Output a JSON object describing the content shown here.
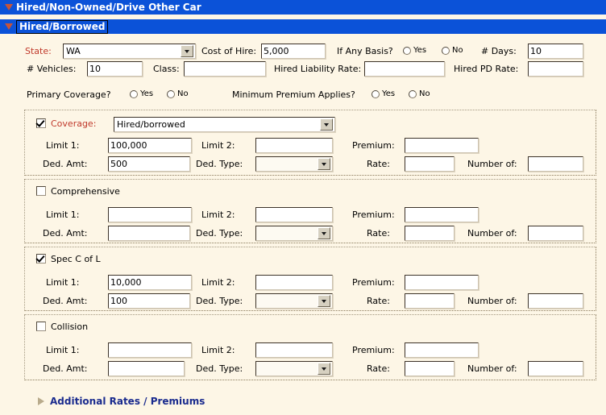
{
  "window": {
    "title": "Hired/Non-Owned/Drive Other Car",
    "subsection_title": "Hired/Borrowed",
    "collapse_icon": "triangle-down-icon"
  },
  "top_form": {
    "state": {
      "label": "State:",
      "value": "WA"
    },
    "cost_of_hire": {
      "label": "Cost of Hire:",
      "value": "5,000"
    },
    "if_any_basis": {
      "label": "If Any Basis?",
      "yes": "Yes",
      "no": "No",
      "selected": ""
    },
    "num_days": {
      "label": "# Days:",
      "value": "10"
    },
    "num_vehicles": {
      "label": "# Vehicles:",
      "value": "10"
    },
    "class": {
      "label": "Class:",
      "value": ""
    },
    "hired_liability_rate": {
      "label": "Hired Liability Rate:",
      "value": ""
    },
    "hired_pd_rate": {
      "label": "Hired PD Rate:",
      "value": ""
    },
    "primary_coverage": {
      "label": "Primary Coverage?",
      "yes": "Yes",
      "no": "No",
      "selected": ""
    },
    "minimum_premium": {
      "label": "Minimum Premium Applies?",
      "yes": "Yes",
      "no": "No",
      "selected": ""
    }
  },
  "field_labels": {
    "limit1": "Limit 1:",
    "limit2": "Limit 2:",
    "premium": "Premium:",
    "ded_amt": "Ded. Amt:",
    "ded_type": "Ded. Type:",
    "rate": "Rate:",
    "number_of": "Number of:"
  },
  "panels": [
    {
      "checkbox_label": "Coverage:",
      "checked": true,
      "label_required": true,
      "has_combo": true,
      "combo_value": "Hired/borrowed",
      "limit1": "100,000",
      "limit2": "",
      "premium": "",
      "ded_amt": "500",
      "ded_type": "",
      "rate": "",
      "number_of": ""
    },
    {
      "checkbox_label": "Comprehensive",
      "checked": false,
      "label_required": false,
      "has_combo": false,
      "combo_value": "",
      "limit1": "",
      "limit2": "",
      "premium": "",
      "ded_amt": "",
      "ded_type": "",
      "rate": "",
      "number_of": ""
    },
    {
      "checkbox_label": "Spec C of L",
      "checked": true,
      "label_required": false,
      "has_combo": false,
      "combo_value": "",
      "limit1": "10,000",
      "limit2": "",
      "premium": "",
      "ded_amt": "100",
      "ded_type": "",
      "rate": "",
      "number_of": ""
    },
    {
      "checkbox_label": "Collision",
      "checked": false,
      "label_required": false,
      "has_combo": false,
      "combo_value": "",
      "limit1": "",
      "limit2": "",
      "premium": "",
      "ded_amt": "",
      "ded_type": "",
      "rate": "",
      "number_of": ""
    }
  ],
  "footer": {
    "additional_rates_label": "Additional Rates / Premiums",
    "expand_icon": "triangle-right-icon"
  },
  "colors": {
    "titlebar": "#0b52d8",
    "background": "#fdf6e6",
    "required_label": "#c0392b",
    "link": "#1a2b8e",
    "triangle": "#c4543b"
  }
}
